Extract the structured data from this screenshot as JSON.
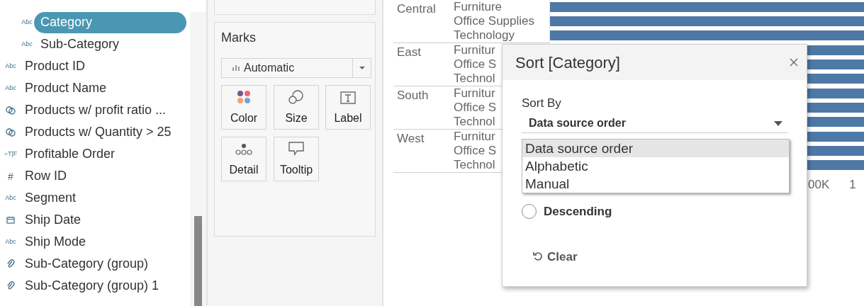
{
  "tables": {
    "hierarchy": [
      {
        "label": "Category",
        "kind": "text",
        "glyph": "Abc",
        "selected": true
      },
      {
        "label": "Sub-Category",
        "kind": "text",
        "glyph": "Abc",
        "selected": false
      }
    ],
    "fields": [
      {
        "label": "Product ID",
        "kind": "text",
        "glyph": "Abc"
      },
      {
        "label": "Product Name",
        "kind": "text",
        "glyph": "Abc"
      },
      {
        "label": "Products w/ profit ratio ...",
        "kind": "set"
      },
      {
        "label": "Products w/ Quantity > 25",
        "kind": "set"
      },
      {
        "label": "Profitable Order",
        "kind": "boolean",
        "glyph": "=T|F"
      },
      {
        "label": "Row ID",
        "kind": "number",
        "glyph": "#"
      },
      {
        "label": "Segment",
        "kind": "text",
        "glyph": "Abc"
      },
      {
        "label": "Ship Date",
        "kind": "date"
      },
      {
        "label": "Ship Mode",
        "kind": "text",
        "glyph": "Abc"
      },
      {
        "label": "Sub-Category (group)",
        "kind": "group"
      },
      {
        "label": "Sub-Category (group) 1",
        "kind": "group"
      }
    ]
  },
  "marks": {
    "title": "Marks",
    "mark_type": "Automatic",
    "cards": [
      {
        "label": "Color",
        "kind": "color"
      },
      {
        "label": "Size",
        "kind": "size"
      },
      {
        "label": "Label",
        "kind": "label"
      },
      {
        "label": "Detail",
        "kind": "detail"
      },
      {
        "label": "Tooltip",
        "kind": "tooltip"
      }
    ]
  },
  "view": {
    "groups": [
      {
        "region": "Central",
        "categories": [
          "Furniture",
          "Office Supplies",
          "Technology"
        ]
      },
      {
        "region": "East",
        "categories": [
          "Furnitur",
          "Office S",
          "Technol"
        ]
      },
      {
        "region": "South",
        "categories": [
          "Furnitur",
          "Office S",
          "Technol"
        ]
      },
      {
        "region": "West",
        "categories": [
          "Furnitur",
          "Office S",
          "Technol"
        ]
      }
    ],
    "axis_labels": [
      "00K",
      "1"
    ]
  },
  "dialog": {
    "title": "Sort [Category]",
    "sort_by_label": "Sort By",
    "sort_by_value": "Data source order",
    "options": [
      {
        "label": "Data source order",
        "selected": true
      },
      {
        "label": "Alphabetic",
        "selected": false
      },
      {
        "label": "Manual",
        "selected": false
      }
    ],
    "order_options": [
      {
        "label": "Descending",
        "selected": false
      }
    ],
    "clear_label": "Clear"
  }
}
